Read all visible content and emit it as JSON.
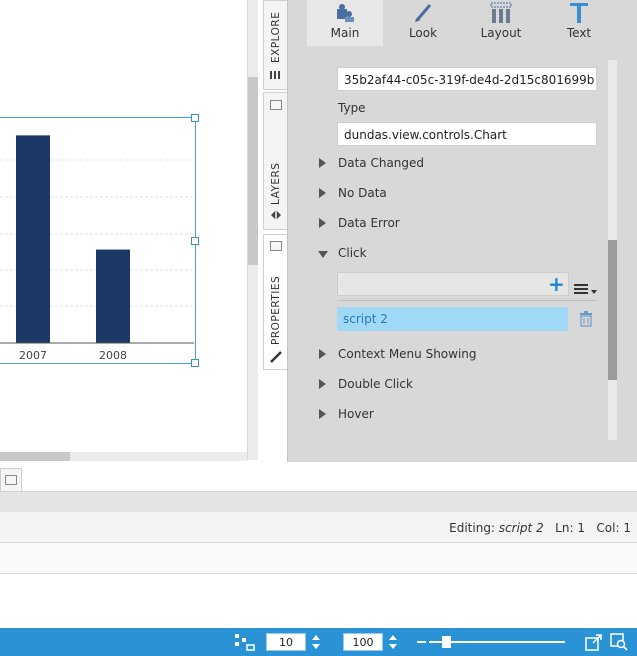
{
  "chart_data": {
    "type": "bar",
    "categories": [
      "2007",
      "2008"
    ],
    "values": [
      100,
      45
    ],
    "ylim": [
      0,
      105
    ],
    "colors": {
      "bar": "#1c3866"
    }
  },
  "side_tabs": [
    {
      "label": "EXPLORE"
    },
    {
      "label": "LAYERS"
    },
    {
      "label": "PROPERTIES"
    }
  ],
  "toolbar": {
    "buttons": [
      {
        "label": "Main",
        "icon": "puzzle-icon"
      },
      {
        "label": "Look",
        "icon": "paintbrush-icon"
      },
      {
        "label": "Layout",
        "icon": "layout-columns-icon"
      },
      {
        "label": "Text",
        "icon": "text-t-icon"
      }
    ]
  },
  "properties": {
    "id_value": "35b2af44-c05c-319f-de4d-2d15c801699b",
    "type_label": "Type",
    "type_value": "dundas.view.controls.Chart",
    "events": {
      "data_changed": "Data Changed",
      "no_data": "No Data",
      "data_error": "Data Error",
      "click": "Click",
      "context_menu": "Context Menu Showing",
      "double_click": "Double Click",
      "hover": "Hover"
    },
    "click_scripts": [
      "script 2"
    ]
  },
  "editor": {
    "editing_label": "Editing:",
    "editing_value": "script 2",
    "ln_label": "Ln:",
    "ln_value": "1",
    "col_label": "Col:",
    "col_value": "1"
  },
  "statusbar": {
    "grid_size": "10",
    "zoom": "100",
    "zoom_fraction": 0.1
  },
  "colors": {
    "accent": "#2a93d5",
    "selected_script": "#9fd9f5",
    "add_icon": "#1a8ad4"
  }
}
